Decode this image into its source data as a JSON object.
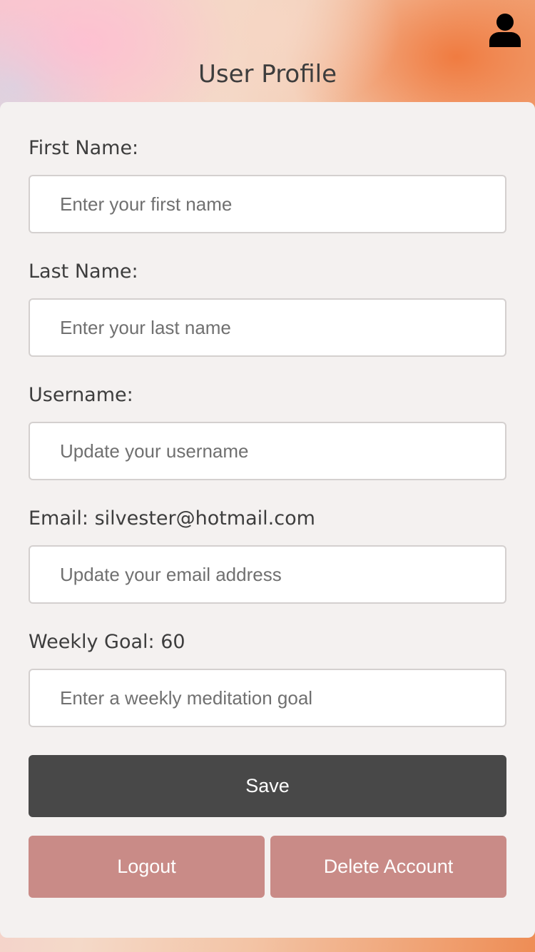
{
  "header": {
    "title": "User Profile",
    "profile_icon": "user-icon"
  },
  "form": {
    "first_name": {
      "label": "First Name:",
      "placeholder": "Enter your first name",
      "value": ""
    },
    "last_name": {
      "label": "Last Name:",
      "placeholder": "Enter your last name",
      "value": ""
    },
    "username": {
      "label": "Username:",
      "placeholder": "Update your username",
      "value": ""
    },
    "email": {
      "label": "Email: silvester@hotmail.com",
      "placeholder": "Update your email address",
      "value": ""
    },
    "weekly_goal": {
      "label": "Weekly Goal: 60",
      "placeholder": "Enter a weekly meditation goal",
      "value": ""
    }
  },
  "actions": {
    "save_label": "Save",
    "logout_label": "Logout",
    "delete_label": "Delete Account"
  },
  "colors": {
    "save_button": "#484848",
    "secondary_buttons": "#c98b87",
    "card_background": "#f4f1f0",
    "text": "#3d3d3d"
  }
}
